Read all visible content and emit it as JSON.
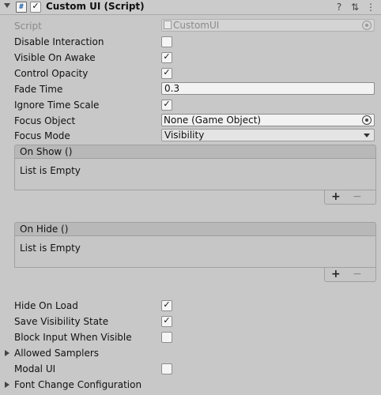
{
  "header": {
    "title": "Custom UI (Script)",
    "help_icon": "?",
    "settings_icon": "⇅",
    "menu_icon": "⋮"
  },
  "fields": {
    "script_label": "Script",
    "script_value": "CustomUI",
    "disable_interaction": "Disable Interaction",
    "visible_on_awake": "Visible On Awake",
    "control_opacity": "Control Opacity",
    "fade_time_label": "Fade Time",
    "fade_time_value": "0.3",
    "ignore_time_scale": "Ignore Time Scale",
    "focus_object_label": "Focus Object",
    "focus_object_value": "None (Game Object)",
    "focus_mode_label": "Focus Mode",
    "focus_mode_value": "Visibility",
    "hide_on_load": "Hide On Load",
    "save_visibility_state": "Save Visibility State",
    "block_input_when_visible": "Block Input When Visible",
    "allowed_samplers": "Allowed Samplers",
    "modal_ui": "Modal UI",
    "font_change_configuration": "Font Change Configuration"
  },
  "checks": {
    "disable_interaction": false,
    "visible_on_awake": true,
    "control_opacity": true,
    "ignore_time_scale": true,
    "hide_on_load": true,
    "save_visibility_state": true,
    "block_input_when_visible": false,
    "modal_ui": false
  },
  "events": {
    "on_show_title": "On Show ()",
    "on_hide_title": "On Hide ()",
    "empty_text": "List is Empty",
    "plus": "+",
    "minus": "−"
  }
}
